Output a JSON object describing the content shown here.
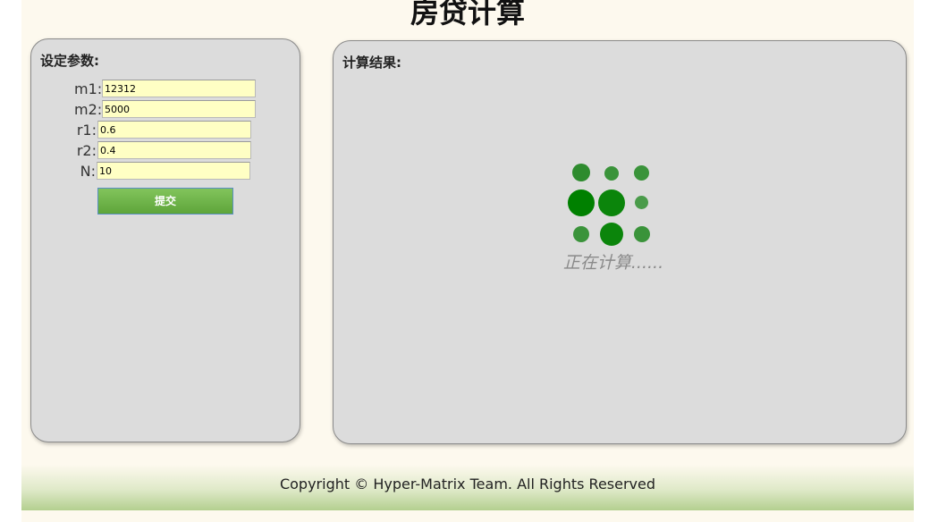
{
  "page": {
    "title": "房贷计算"
  },
  "params": {
    "heading": "设定参数:",
    "fields": [
      {
        "label": "m1:",
        "value": "12312"
      },
      {
        "label": "m2:",
        "value": "5000"
      },
      {
        "label": "r1:",
        "value": "0.6"
      },
      {
        "label": "r2:",
        "value": "0.4"
      },
      {
        "label": "N:",
        "value": "10"
      }
    ],
    "submit_label": "提交"
  },
  "result": {
    "heading": "计算结果:",
    "loading_text": "正在计算......",
    "spinner_icon": "loading-dots-icon"
  },
  "footer": {
    "copyright": "Copyright © Hyper-Matrix Team. All Rights Reserved"
  },
  "colors": {
    "page_background": "#fdf9ee",
    "panel_background": "#dcdcdc",
    "input_background": "#ffffc4",
    "button_green": "#6fb449",
    "spinner_green": "#008000"
  }
}
